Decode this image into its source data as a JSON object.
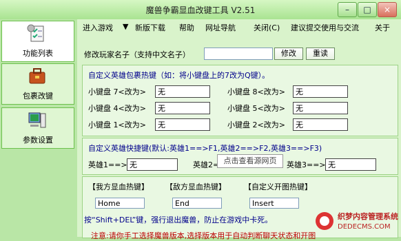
{
  "window": {
    "title": "魔兽争霸显血改键工具 V2.51",
    "min_symbol": "–",
    "max_symbol": "□",
    "close_symbol": "×"
  },
  "sidebar": {
    "items": [
      {
        "label": "功能列表",
        "icon": "checklist-icon"
      },
      {
        "label": "包裹改键",
        "icon": "briefcase-icon"
      },
      {
        "label": "参数设置",
        "icon": "computer-icon"
      }
    ]
  },
  "menu": [
    "进入游戏",
    "▼",
    "新版下载",
    "帮助",
    "网址导航",
    "关闭(C)",
    "建议提交使用与交流",
    "关于"
  ],
  "rename": {
    "label": "修改玩家名子（支持中文名子）",
    "value": "",
    "modify_btn": "修改",
    "reset_btn": "重读"
  },
  "bag_panel": {
    "title": "自定义英雄包裹热键（如：将小键盘上的7改为Q键）。",
    "slots": [
      {
        "label": "小键盘 7<改为>",
        "value": "无"
      },
      {
        "label": "小键盘 8<改为>",
        "value": "无"
      },
      {
        "label": "小键盘 4<改为>",
        "value": "无"
      },
      {
        "label": "小键盘 5<改为>",
        "value": "无"
      },
      {
        "label": "小键盘 1<改为>",
        "value": "无"
      },
      {
        "label": "小键盘 2<改为>",
        "value": "无"
      }
    ]
  },
  "hero_panel": {
    "title": "自定义英雄快捷键(默认:英雄1==>F1,英雄2==>F2,英雄3==>F3)",
    "heroes": [
      {
        "label": "英雄1==>",
        "value": "无"
      },
      {
        "label": "英雄2==>",
        "value": ""
      },
      {
        "label": "英雄3==>",
        "value": "无"
      }
    ]
  },
  "tooltip": "点击查看源网页",
  "hotkeys": {
    "own": {
      "label": "【我方显血热键】",
      "value": "Home"
    },
    "enemy": {
      "label": "【敌方显血热键】",
      "value": "End"
    },
    "custom": {
      "label": "【自定义开图热键】",
      "value": "Insert"
    }
  },
  "exit_note": "按“Shift+DEL”键，强行退出魔兽，防止在游戏中卡死。",
  "bottom_note": "注意:请你手工选择魔兽版本,选择版本用于自动判断聊天状态和开图",
  "watermark": {
    "line1": "织梦内容管理系统",
    "line2": "DEDECMS.COM"
  },
  "colors": {
    "title_blue": "#00008b",
    "window_green": "#b9e6a6",
    "close_red": "#d86f5c"
  }
}
